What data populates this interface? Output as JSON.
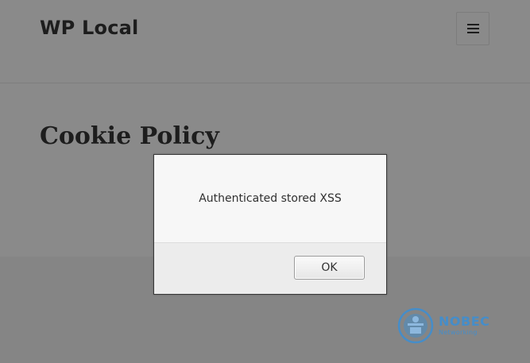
{
  "site": {
    "title": "WP Local"
  },
  "menu": {
    "icon": "hamburger-menu-icon"
  },
  "page": {
    "title": "Cookie Policy"
  },
  "alert": {
    "message": "Authenticated stored XSS",
    "ok_label": "OK"
  },
  "watermark": {
    "name": "NOBEC",
    "subtitle": "Networking",
    "color": "#3b8fd6",
    "icon": "nobec-logo-icon"
  },
  "colors": {
    "overlay_background": "#858585",
    "dialog_background": "#f7f7f7",
    "dialog_footer": "#ececec",
    "text_dark": "#1d1d1d"
  }
}
